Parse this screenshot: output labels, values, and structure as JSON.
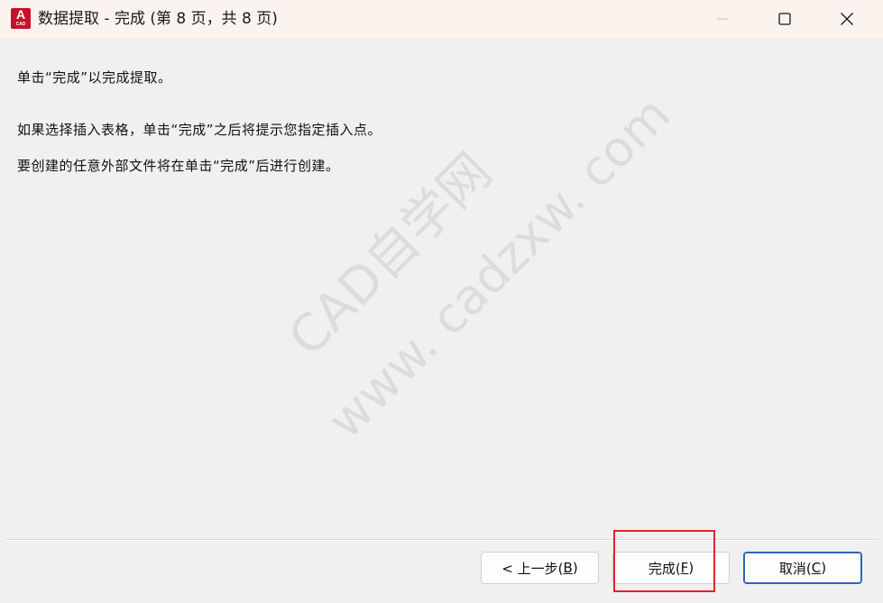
{
  "window": {
    "title": "数据提取 - 完成 (第 8 页，共 8 页)",
    "app_icon_letter": "A",
    "app_icon_caption": "CAD"
  },
  "content": {
    "line1": "单击“完成”以完成提取。",
    "line2": "如果选择插入表格，单击“完成”之后将提示您指定插入点。",
    "line3": "要创建的任意外部文件将在单击“完成”后进行创建。"
  },
  "watermark": {
    "line1": "CAD自学网",
    "line2": "www. cadzxw. com"
  },
  "buttons": {
    "back": {
      "label": "< 上一步(",
      "mnemonic": "B",
      "suffix": ")"
    },
    "finish": {
      "label": "完成(",
      "mnemonic": "F",
      "suffix": ")"
    },
    "cancel": {
      "label": "取消(",
      "mnemonic": "C",
      "suffix": ")"
    }
  },
  "icons": {
    "minimize": "minimize-icon",
    "maximize": "maximize-icon",
    "close": "close-icon"
  },
  "colors": {
    "titlebar": "#fbf3ee",
    "app_icon": "#c8102e",
    "highlight": "#e62424",
    "default_button_border": "#2f64b8",
    "watermark": "#dcdcdc"
  }
}
